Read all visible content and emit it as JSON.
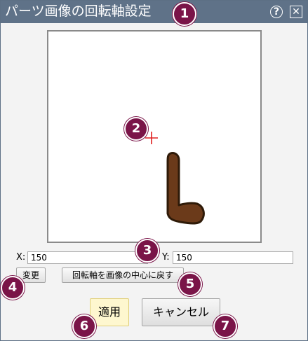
{
  "window": {
    "title": "パーツ画像の回転軸設定"
  },
  "titlebar": {
    "help_icon": "?",
    "close_icon": "✕"
  },
  "coords": {
    "x_label": "X:",
    "x_value": "150",
    "y_label": "Y:",
    "y_value": "150"
  },
  "buttons": {
    "change": "変更",
    "reset_center": "回転軸を画像の中心に戻す",
    "apply": "適用",
    "cancel": "キャンセル"
  },
  "badges": [
    "1",
    "2",
    "3",
    "4",
    "5",
    "6",
    "7"
  ],
  "colors": {
    "titlebar": "#5f7288",
    "badge": "#7a1448",
    "crosshair": "#e02020",
    "part_fill": "#6b3a1a",
    "apply_bg": "#fef7cf"
  }
}
